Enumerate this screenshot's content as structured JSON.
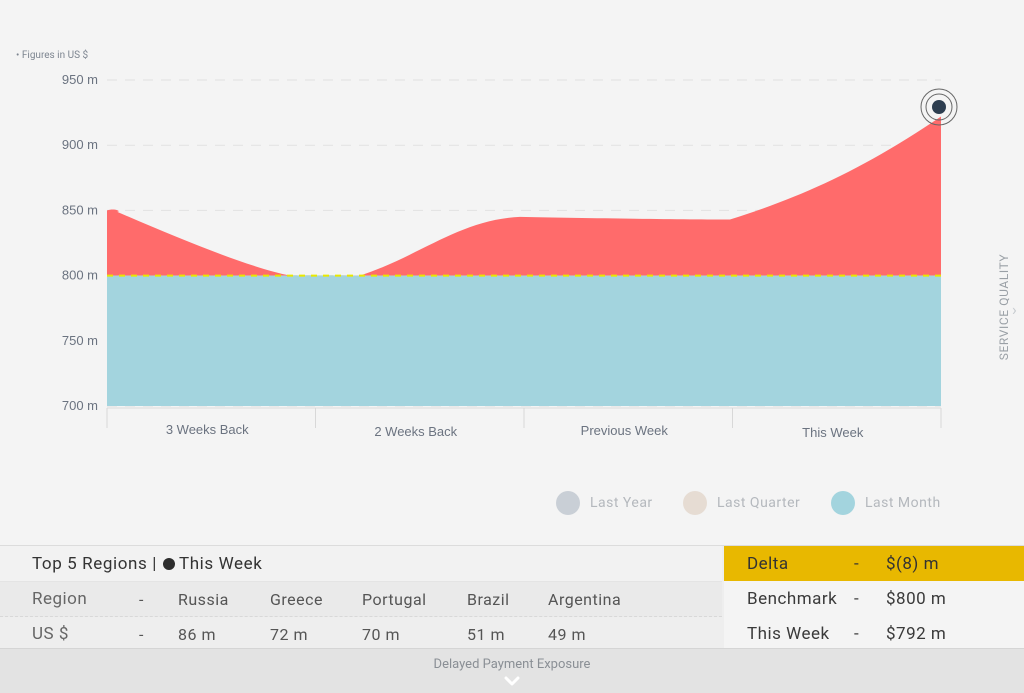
{
  "note": "• Figures in US $",
  "side_tab": {
    "label": "SERVICE QUALITY"
  },
  "chart_data": {
    "type": "area",
    "y_ticks": [
      "950 m",
      "900 m",
      "850 m",
      "800 m",
      "750 m",
      "700 m"
    ],
    "ylim": [
      700,
      950
    ],
    "categories": [
      "3 Weeks Back",
      "2 Weeks  Back",
      "Previous Week",
      "This Week"
    ],
    "benchmark": 800,
    "series": [
      {
        "name": "Last Month",
        "color": "#a3d4de",
        "values": [
          800,
          800,
          800,
          800
        ]
      }
    ],
    "area_values": [
      850,
      800,
      844,
      922
    ],
    "colors": {
      "above": "#ff6b6b",
      "below": "#4caf50",
      "base": "#a3d4de",
      "benchmark_line": "#e8e800"
    }
  },
  "legend": [
    {
      "label": "Last Year",
      "color": "#c9cfd6"
    },
    {
      "label": "Last Quarter",
      "color": "#e6dcd3"
    },
    {
      "label": "Last Month",
      "color": "#a3d4de"
    }
  ],
  "regions": {
    "title": "Top 5 Regions |",
    "title_suffix": "This Week",
    "head_label": "Region",
    "dash": "-",
    "names": [
      "Russia",
      "Greece",
      "Portugal",
      "Brazil",
      "Argentina"
    ],
    "value_label": "US $",
    "values": [
      "86 m",
      "72 m",
      "70 m",
      "51 m",
      "49 m"
    ]
  },
  "summary": {
    "delta_label": "Delta",
    "delta_value": "$(8) m",
    "bench_label": "Benchmark",
    "bench_value": "$800 m",
    "week_label": "This Week",
    "week_value": "$792 m",
    "dash": "-"
  },
  "footer": {
    "label": "Delayed Payment Exposure"
  }
}
